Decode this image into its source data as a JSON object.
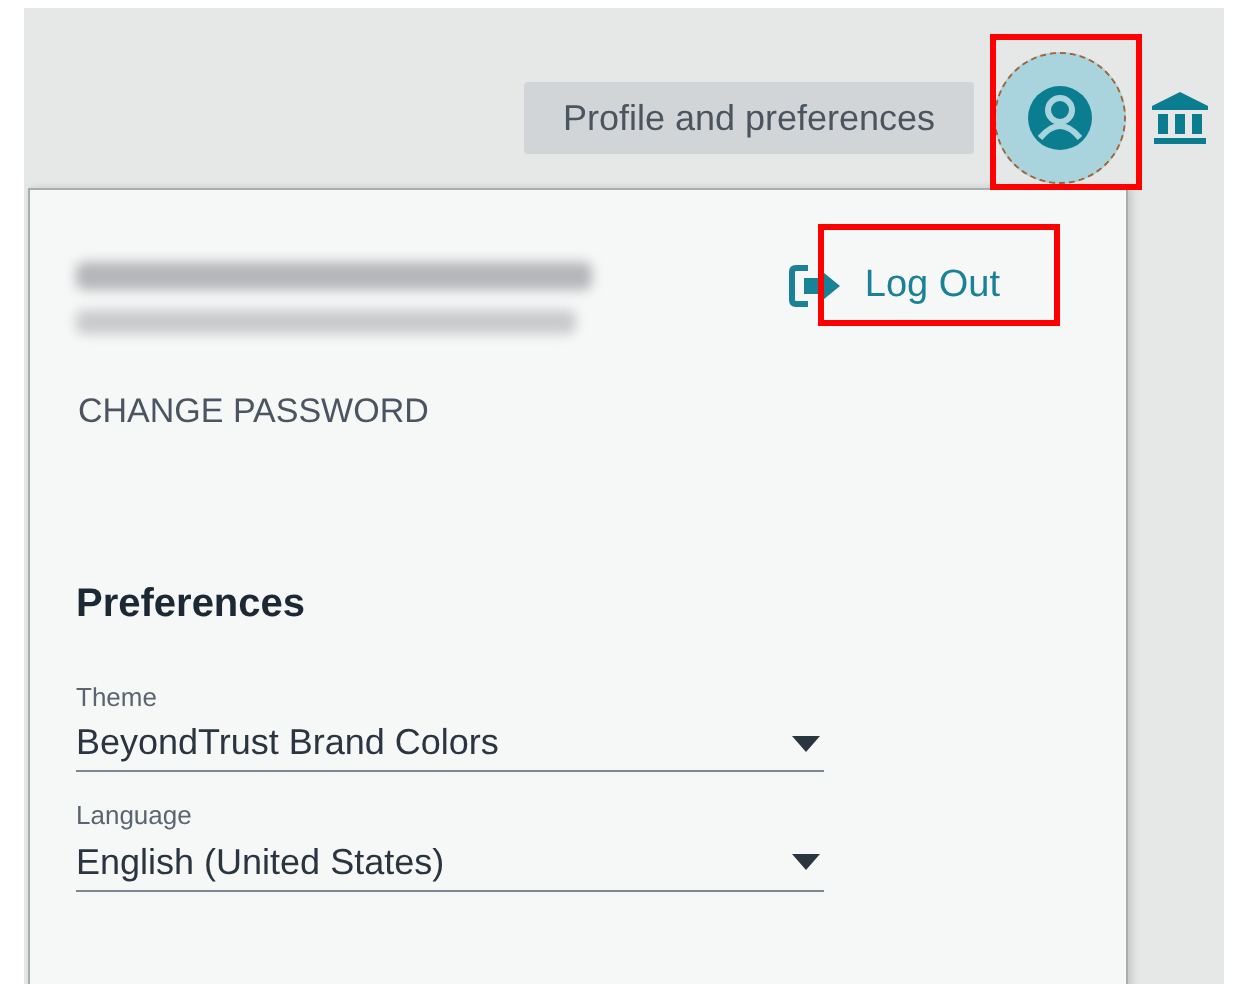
{
  "tooltip": "Profile and preferences",
  "account": {
    "logout": "Log Out",
    "change_password": "CHANGE PASSWORD"
  },
  "preferences": {
    "title": "Preferences",
    "fields": [
      {
        "label": "Theme",
        "value": "BeyondTrust Brand Colors"
      },
      {
        "label": "Language",
        "value": "English (United States)"
      }
    ]
  }
}
